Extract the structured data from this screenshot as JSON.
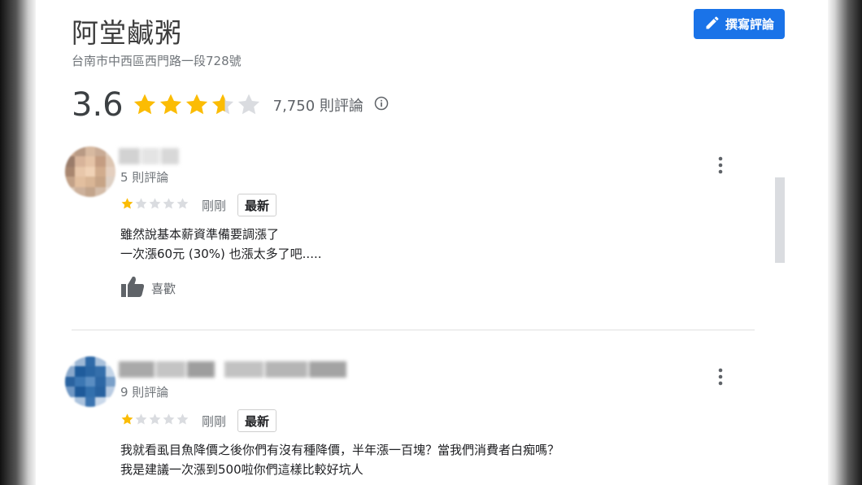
{
  "place": {
    "name": "阿堂鹹粥",
    "address": "台南市中西區西門路一段728號"
  },
  "write_review": {
    "label": "撰寫評論",
    "color": "#1a73e8",
    "icon": "pencil-icon"
  },
  "summary": {
    "rating": "3.6",
    "rating_value": 3.6,
    "stars_max": 5,
    "count_text": "7,750 則評論",
    "info_icon": "info-icon"
  },
  "colors": {
    "star_filled": "#fbbc04",
    "star_empty": "#dadce0"
  },
  "reviews": [
    {
      "review_count": "5 則評論",
      "stars": 1,
      "time": "剛剛",
      "badge": "最新",
      "lines": [
        "雖然說基本薪資準備要調漲了",
        "一次漲60元 (30%) 也漲太多了吧....."
      ],
      "like_label": "喜歡"
    },
    {
      "review_count": "9 則評論",
      "stars": 1,
      "time": "剛剛",
      "badge": "最新",
      "lines": [
        "我就看虱目魚降價之後你們有沒有種降價，半年漲一百塊？當我們消費者白痴嗎？",
        "我是建議一次漲到500啦你們這樣比較好坑人"
      ]
    }
  ]
}
